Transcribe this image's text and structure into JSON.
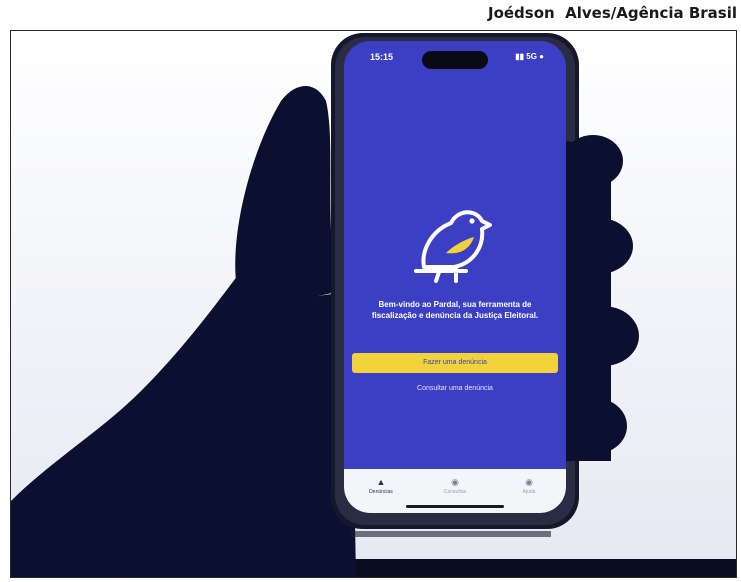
{
  "photo_credit": "Joédson  Alves/Agência Brasil",
  "phone": {
    "status_time": "15:15",
    "status_icons": "▮▮ 5G ●",
    "welcome_text": "Bem-vindo ao Pardal, sua ferramenta de fiscalização e denúncia da Justiça Eleitoral.",
    "primary_button": "Fazer uma denúncia",
    "secondary_link": "Consultar uma denúncia",
    "tabs": [
      {
        "label": "Denúncias",
        "icon": "alert-icon"
      },
      {
        "label": "Consultas",
        "icon": "info-icon"
      },
      {
        "label": "Ajuda",
        "icon": "help-icon"
      }
    ]
  },
  "colors": {
    "screen_blue": "#3a3fc4",
    "button_yellow": "#f1d23a",
    "hand_silhouette": "#0b1030"
  }
}
